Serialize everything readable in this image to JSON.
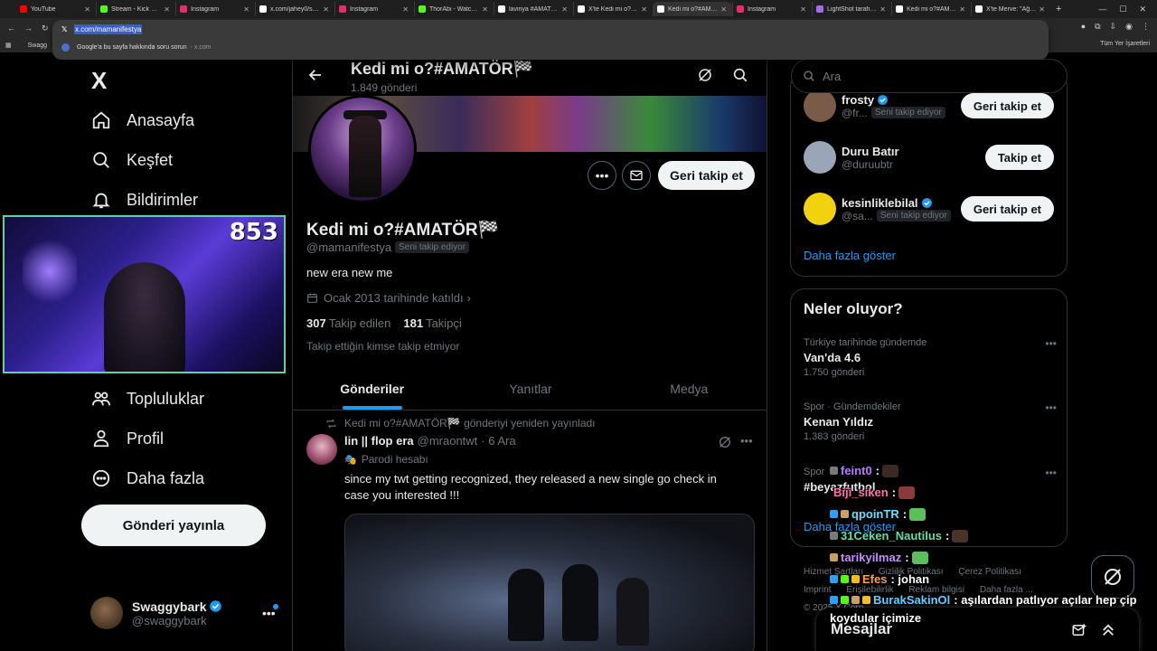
{
  "browser": {
    "tabs": [
      {
        "title": "YouTube",
        "color": "#ff0000"
      },
      {
        "title": "Stream - Kick Dashb",
        "color": "#53fc18"
      },
      {
        "title": "Instagram",
        "color": "#e1306c"
      },
      {
        "title": "x.com/jahey0/statu",
        "color": "#ffffff"
      },
      {
        "title": "Instagram",
        "color": "#e1306c"
      },
      {
        "title": "ThorAbi - Watch cli",
        "color": "#53fc18"
      },
      {
        "title": "lavinya #AMATÖR",
        "color": "#ffffff"
      },
      {
        "title": "X'te Kedi mi o?#AM",
        "color": "#ffffff"
      },
      {
        "title": "Kedi mi o?#AMATÖ",
        "color": "#ffffff"
      },
      {
        "title": "Instagram",
        "color": "#e1306c"
      },
      {
        "title": "LightShot tarafında",
        "color": "#a36cf0"
      },
      {
        "title": "Kedi mi o?#AMATÖ",
        "color": "#ffffff"
      },
      {
        "title": "X'te Merve: \"Ağ, ç",
        "color": "#ffffff"
      }
    ],
    "url": "x.com/mamanifestya",
    "suggestion": "Google'a bu sayfa hakkında soru sorun",
    "suggestion_src": "- x.com",
    "bookmark": "Swagg",
    "bookmarks_right": "Tüm Yer İşaretleri"
  },
  "nav": {
    "logo": "X",
    "items": [
      {
        "label": "Anasayfa",
        "icon": "home-icon"
      },
      {
        "label": "Keşfet",
        "icon": "search-icon"
      },
      {
        "label": "Bildirimler",
        "icon": "bell-icon"
      },
      {
        "label": "Topluluklar",
        "icon": "communities-icon"
      },
      {
        "label": "Profil",
        "icon": "profile-icon"
      },
      {
        "label": "Daha fazla",
        "icon": "more-circle-icon"
      }
    ],
    "post_button": "Gönderi yayınla",
    "account": {
      "name": "Swaggybark",
      "handle": "@swaggybark"
    }
  },
  "webcam": {
    "count": "853"
  },
  "profile": {
    "header_name": "Kedi mi o?#AMATÖR🏁",
    "header_posts": "1.849 gönderi",
    "name": "Kedi mi o?#AMATÖR🏁",
    "handle": "@mamanifestya",
    "follows_you": "Seni takip ediyor",
    "bio": "new era new me",
    "joined": "Ocak 2013 tarihinde katıldı",
    "following_count": "307",
    "following_label": "Takip edilen",
    "followers_count": "181",
    "followers_label": "Takipçi",
    "note": "Takip ettiğin kimse takip etmiyor",
    "follow_back": "Geri takip et",
    "tabs": [
      "Gönderiler",
      "Yanıtlar",
      "Medya"
    ]
  },
  "tweet": {
    "repost_line": "Kedi mi o?#AMATÖR🏁 gönderiyi yeniden yayınladı",
    "author": "lin || flop era",
    "handle": "@mraontwt",
    "date": "· 6 Ara",
    "parody": "Parodi hesabı",
    "text": "since my twt getting recognized, they released a new single go check in case you interested !!!"
  },
  "right": {
    "search_placeholder": "Ara",
    "suggestions": [
      {
        "name": "frosty",
        "handle": "@fr...",
        "badge": "Seni takip ediyor",
        "button": "Geri takip et",
        "color": "#7a5a48"
      },
      {
        "name": "Duru Batır",
        "handle": "@duruubtr",
        "badge": "",
        "button": "Takip et",
        "color": "#9aa6b8"
      },
      {
        "name": "kesinliklebilal",
        "handle": "@sa...",
        "badge": "Seni takip ediyor",
        "button": "Geri takip et",
        "color": "#f2d20f"
      }
    ],
    "show_more": "Daha fazla göster",
    "trends_title": "Neler oluyor?",
    "trends": [
      {
        "context": "Türkiye tarihinde gündemde",
        "name": "Van'da 4.6",
        "count": "1.750 gönderi"
      },
      {
        "context": "Spor · Gündemdekiler",
        "name": "Kenan Yıldız",
        "count": "1.383 gönderi"
      },
      {
        "context": "Spor",
        "name": "#beyazfutbol",
        "count": ""
      }
    ],
    "trends_more": "Daha fazla göster",
    "footer": [
      "Hizmet Şartları",
      "Gizlilik Politikası",
      "Çerez Politikası",
      "Imprint",
      "Erişilebilirlik",
      "Reklam bilgisi",
      "Daha fazla ...",
      "© 2025 X Corp."
    ],
    "messages": "Mesajlar"
  },
  "chat": [
    {
      "user": "feint0",
      "text": ":",
      "color": "#b57cff"
    },
    {
      "user": "Biji_siken",
      "text": ":",
      "color": "#ff6ea8"
    },
    {
      "user": "qpoinTR",
      "text": ":",
      "color": "#6fdcff"
    },
    {
      "user": "31Ceken_Nautilus",
      "text": ":",
      "color": "#5fe0a0"
    },
    {
      "user": "tarikyilmaz",
      "text": ":",
      "color": "#c58cff"
    },
    {
      "user": "Efes",
      "text": ": johan",
      "color": "#ffa040"
    },
    {
      "user": "BurakSakinOl",
      "text": ": aşılardan patlıyor açılar hep çip",
      "color": "#5fd0ff"
    },
    {
      "user": "",
      "text": "koydular içimize",
      "color": "#ffffff"
    }
  ]
}
